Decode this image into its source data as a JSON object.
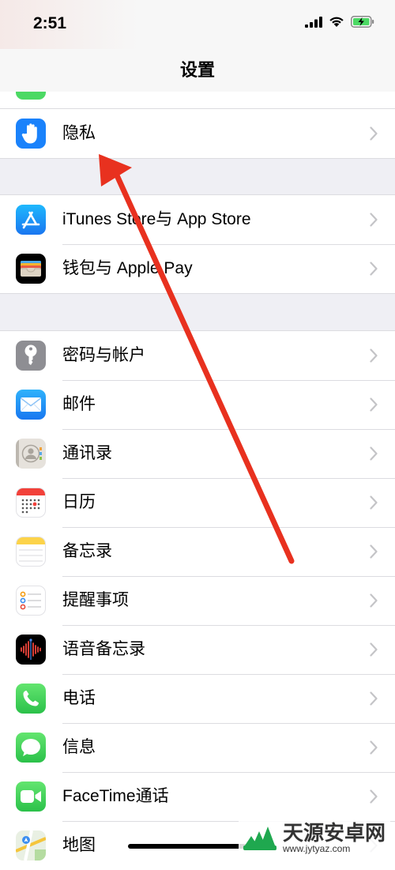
{
  "status_bar": {
    "time": "2:51"
  },
  "nav": {
    "title": "设置"
  },
  "groups": [
    {
      "items": [
        {
          "label": "隐私",
          "icon": "hand-icon",
          "color": "#1a82fb"
        }
      ]
    },
    {
      "items": [
        {
          "label": "iTunes Store与 App Store",
          "icon": "app-store-icon",
          "color": "#1a9cf9"
        },
        {
          "label": "钱包与 Apple Pay",
          "icon": "wallet-icon",
          "color": "#000000"
        }
      ]
    },
    {
      "items": [
        {
          "label": "密码与帐户",
          "icon": "key-icon",
          "color": "#8e8e93"
        },
        {
          "label": "邮件",
          "icon": "mail-icon",
          "color": "#1e8ef8"
        },
        {
          "label": "通讯录",
          "icon": "contacts-icon",
          "color": "#d9d5cf"
        },
        {
          "label": "日历",
          "icon": "calendar-icon",
          "color": "#ffffff"
        },
        {
          "label": "备忘录",
          "icon": "notes-icon",
          "color": "#ffffff"
        },
        {
          "label": "提醒事项",
          "icon": "reminders-icon",
          "color": "#ffffff"
        },
        {
          "label": "语音备忘录",
          "icon": "voice-memos-icon",
          "color": "#000000"
        },
        {
          "label": "电话",
          "icon": "phone-icon",
          "color": "#4cd964"
        },
        {
          "label": "信息",
          "icon": "messages-icon",
          "color": "#4cd964"
        },
        {
          "label": "FaceTime通话",
          "icon": "facetime-icon",
          "color": "#4cd964"
        },
        {
          "label": "地图",
          "icon": "maps-icon",
          "color": "#e8f0e0"
        }
      ]
    }
  ],
  "watermark": {
    "brand": "天源安卓网",
    "url": "www.jytyaz.com"
  },
  "colors": {
    "arrow": "#e8311f",
    "background": "#efeff4"
  }
}
